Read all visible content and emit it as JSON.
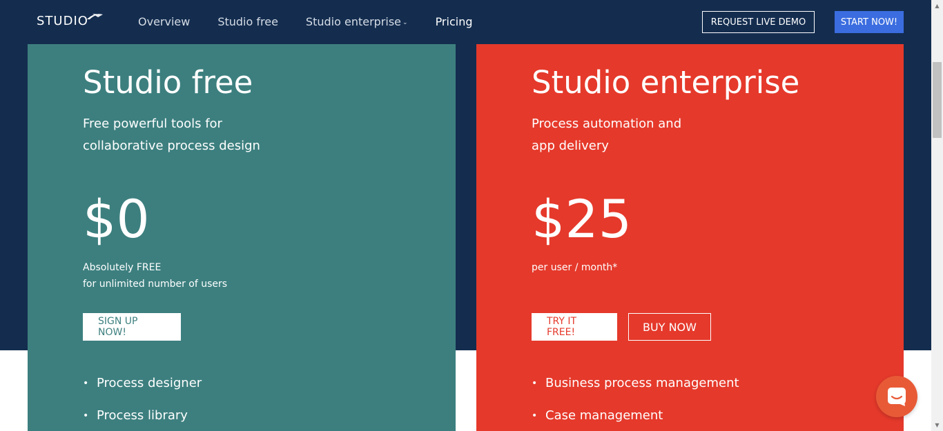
{
  "nav": {
    "logo": "STUDIO",
    "links": [
      {
        "label": "Overview",
        "dropdown": false
      },
      {
        "label": "Studio free",
        "dropdown": false
      },
      {
        "label": "Studio enterprise",
        "dropdown": true
      },
      {
        "label": "Pricing",
        "dropdown": false,
        "active": true
      }
    ],
    "demo_label": "REQUEST LIVE DEMO",
    "start_label": "START NOW!"
  },
  "plans": {
    "free": {
      "title": "Studio free",
      "subtitle_lines": [
        "Free powerful tools for",
        "collaborative process design"
      ],
      "price": "$0",
      "note_lines": [
        "Absolutely FREE",
        "for unlimited number of users"
      ],
      "primary_button": "SIGN UP NOW!",
      "features": [
        "Process designer",
        "Process library"
      ],
      "color": "#3d7f7f"
    },
    "enterprise": {
      "title": "Studio enterprise",
      "subtitle_lines": [
        "Process automation and",
        "app delivery"
      ],
      "price": "$25",
      "note_lines": [
        "per user / month*"
      ],
      "primary_button": "TRY IT FREE!",
      "secondary_button": "BUY NOW",
      "features": [
        "Business process management",
        "Case management"
      ],
      "color": "#e5392b"
    }
  },
  "colors": {
    "hero_bg": "#142d4f",
    "start_button": "#3b6de0",
    "chat_widget": "#e85a36"
  },
  "icons": {
    "chat": "chat-bubble-icon",
    "logo": "swoosh-icon"
  }
}
